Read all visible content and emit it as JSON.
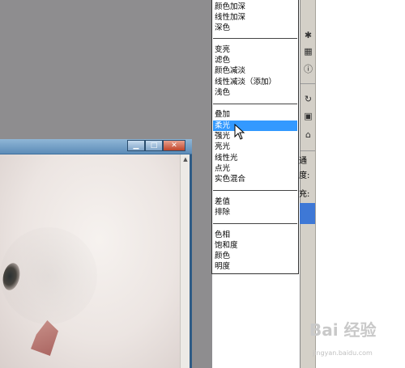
{
  "blend_menu": {
    "items": [
      "颜色加深",
      "线性加深",
      "深色",
      "变亮",
      "滤色",
      "颜色减淡",
      "线性减淡（添加）",
      "浅色",
      "叠加",
      "柔光",
      "强光",
      "亮光",
      "线性光",
      "点光",
      "实色混合",
      "差值",
      "排除",
      "色相",
      "饱和度",
      "颜色",
      "明度"
    ],
    "selected": "柔光"
  },
  "panel": {
    "tab_label": "通",
    "opacity_label": "度:",
    "fill_label": "充:"
  },
  "toolbar_icons": [
    "brush-icon",
    "image-icon",
    "info-icon",
    "layer-icon",
    "channel-icon",
    "path-icon"
  ],
  "watermark": {
    "text": "Bai 经验",
    "sub": "jingyan.baidu.com"
  },
  "colors": {
    "selection": "#3399ff",
    "workspace": "#8e8d8f",
    "window_frame": "#3d6f9c"
  }
}
